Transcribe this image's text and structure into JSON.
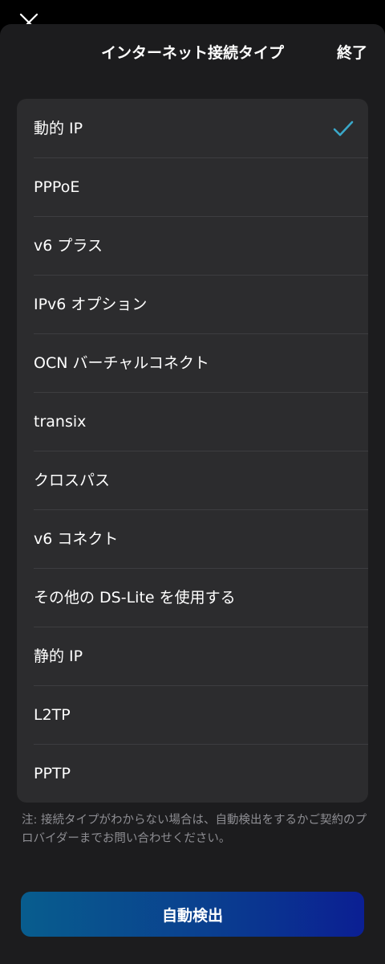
{
  "header": {
    "title": "インターネット接続タイプ",
    "done_label": "終了"
  },
  "options": [
    {
      "label": "動的 IP",
      "selected": true
    },
    {
      "label": "PPPoE",
      "selected": false
    },
    {
      "label": "v6 プラス",
      "selected": false
    },
    {
      "label": "IPv6 オプション",
      "selected": false
    },
    {
      "label": "OCN バーチャルコネクト",
      "selected": false
    },
    {
      "label": "transix",
      "selected": false
    },
    {
      "label": "クロスパス",
      "selected": false
    },
    {
      "label": "v6 コネクト",
      "selected": false
    },
    {
      "label": "その他の DS-Lite を使用する",
      "selected": false
    },
    {
      "label": "静的 IP",
      "selected": false
    },
    {
      "label": "L2TP",
      "selected": false
    },
    {
      "label": "PPTP",
      "selected": false
    }
  ],
  "note": "注: 接続タイプがわからない場合は、自動検出をするかご契約のプロバイダーまでお問い合わせください。",
  "auto_detect_label": "自動検出",
  "colors": {
    "sheet_background": "#1c1c1e",
    "list_background": "#2c2c2e",
    "check_accent": "#3aa8c9",
    "button_gradient_start": "#085d8e",
    "button_gradient_end": "#0b1f93"
  },
  "icons": {
    "close": "close-icon",
    "selected": "checkmark-icon"
  }
}
